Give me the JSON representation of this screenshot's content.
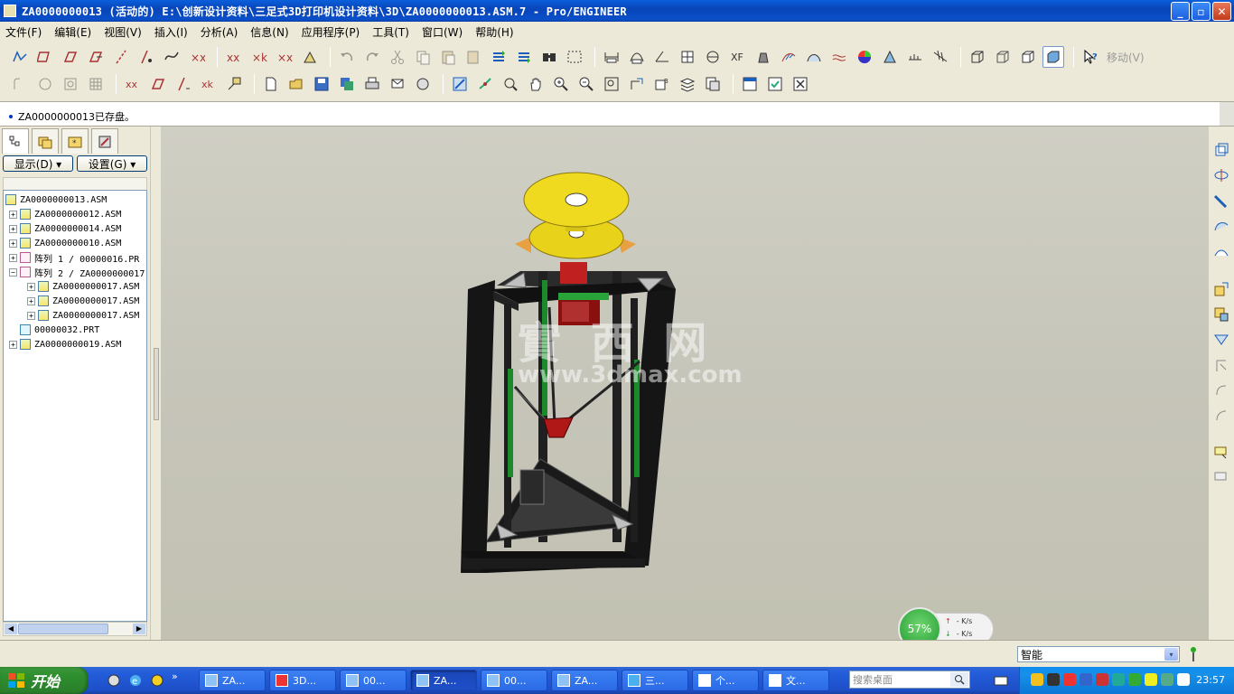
{
  "window": {
    "title": "ZA0000000013 (活动的) E:\\创新设计资料\\三足式3D打印机设计资料\\3D\\ZA0000000013.ASM.7 - Pro/ENGINEER",
    "min_label": "_",
    "max_label": "▫",
    "close_label": "✕"
  },
  "menu": [
    "文件(F)",
    "编辑(E)",
    "视图(V)",
    "插入(I)",
    "分析(A)",
    "信息(N)",
    "应用程序(P)",
    "工具(T)",
    "窗口(W)",
    "帮助(H)"
  ],
  "toolbar": {
    "move_label": "移动(V)"
  },
  "message": {
    "text": "ZA0000000013已存盘。"
  },
  "panel": {
    "show_label": "显示(D) ▾",
    "settings_label": "设置(G) ▾"
  },
  "tree": [
    {
      "label": "ZA0000000013.ASM",
      "kind": "asm",
      "indent": 0,
      "expander": ""
    },
    {
      "label": "ZA0000000012.ASM",
      "kind": "asm",
      "indent": 1,
      "expander": "+"
    },
    {
      "label": "ZA0000000014.ASM",
      "kind": "asm",
      "indent": 1,
      "expander": "+"
    },
    {
      "label": "ZA0000000010.ASM",
      "kind": "asm",
      "indent": 1,
      "expander": "+"
    },
    {
      "label": "阵列 1 / 00000016.PR",
      "kind": "pat",
      "indent": 1,
      "expander": "+"
    },
    {
      "label": "阵列 2 / ZA0000000017",
      "kind": "pat",
      "indent": 1,
      "expander": "−"
    },
    {
      "label": "ZA0000000017.ASM",
      "kind": "asm",
      "indent": 2,
      "expander": "+"
    },
    {
      "label": "ZA0000000017.ASM",
      "kind": "asm",
      "indent": 2,
      "expander": "+"
    },
    {
      "label": "ZA0000000017.ASM",
      "kind": "asm",
      "indent": 2,
      "expander": "+"
    },
    {
      "label": "00000032.PRT",
      "kind": "prt",
      "indent": 1,
      "expander": ""
    },
    {
      "label": "ZA0000000019.ASM",
      "kind": "asm",
      "indent": 1,
      "expander": "+"
    }
  ],
  "watermark": {
    "line1": "實 西 网",
    "line2": "www.3dmax.com"
  },
  "speed": {
    "percent": "57%",
    "up": "- K/s",
    "down": "- K/s"
  },
  "status": {
    "filter_value": "智能",
    "filter_dropdown": "▾"
  },
  "taskbar": {
    "start_label": "开始",
    "search_placeholder": "搜索桌面",
    "clock": "23:57",
    "tasks": [
      "ZA...",
      "3D...",
      "00...",
      "ZA...",
      "00...",
      "ZA...",
      "三...",
      "个...",
      "文..."
    ]
  }
}
